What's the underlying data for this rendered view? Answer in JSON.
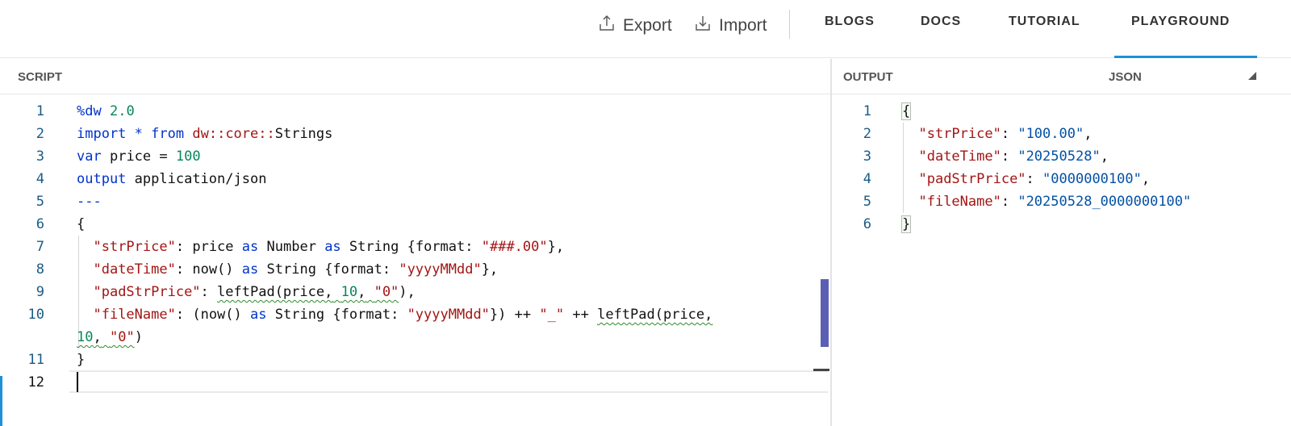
{
  "header": {
    "export_label": "Export",
    "import_label": "Import",
    "nav": [
      "BLOGS",
      "DOCS",
      "TUTORIAL",
      "PLAYGROUND"
    ],
    "active_nav": "PLAYGROUND"
  },
  "script_panel": {
    "title": "SCRIPT",
    "line_numbers": [
      "1",
      "2",
      "3",
      "4",
      "5",
      "6",
      "7",
      "8",
      "9",
      "10",
      "11",
      "12"
    ],
    "lines": {
      "l1": {
        "directive": "%dw",
        "version": "2.0"
      },
      "l2": {
        "kw_import": "import",
        "star": "*",
        "kw_from": "from",
        "module": "dw::core::",
        "module_name": "Strings"
      },
      "l3": {
        "kw_var": "var",
        "name": "price",
        "eq": "=",
        "value": "100"
      },
      "l4": {
        "kw_output": "output",
        "mime": "application/json"
      },
      "l5": {
        "separator": "---"
      },
      "l6": {
        "brace": "{"
      },
      "l7": {
        "key": "\"strPrice\"",
        "colon": ":",
        "expr1": "price",
        "as1": "as",
        "type1": "Number",
        "as2": "as",
        "type2": "String",
        "open": "{format:",
        "fmt": "\"###.00\"",
        "close": "},"
      },
      "l8": {
        "key": "\"dateTime\"",
        "colon": ":",
        "expr1": "now()",
        "as1": "as",
        "type1": "String",
        "open": "{format:",
        "fmt": "\"yyyyMMdd\"",
        "close": "},"
      },
      "l9": {
        "key": "\"padStrPrice\"",
        "colon": ":",
        "fn": "leftPad(price,",
        "arg1": "10",
        "comma": ",",
        "arg2": "\"0\"",
        "close": "),"
      },
      "l10": {
        "key": "\"fileName\"",
        "colon": ":",
        "open": "(now()",
        "as1": "as",
        "type1": "String",
        "open2": "{format:",
        "fmt": "\"yyyyMMdd\"",
        "close": "})",
        "concat1": "++",
        "underscore": "\"_\"",
        "concat2": "++",
        "fn": "leftPad(price,"
      },
      "l10b": {
        "arg1": "10",
        "comma": ",",
        "arg2": "\"0\"",
        "close": ")"
      },
      "l11": {
        "brace": "}"
      }
    }
  },
  "output_panel": {
    "title": "OUTPUT",
    "format": "JSON",
    "line_numbers": [
      "1",
      "2",
      "3",
      "4",
      "5",
      "6"
    ],
    "open_brace": "{",
    "close_brace": "}",
    "entries": [
      {
        "key": "\"strPrice\"",
        "value": "\"100.00\"",
        "tail": ","
      },
      {
        "key": "\"dateTime\"",
        "value": "\"20250528\"",
        "tail": ","
      },
      {
        "key": "\"padStrPrice\"",
        "value": "\"0000000100\"",
        "tail": ","
      },
      {
        "key": "\"fileName\"",
        "value": "\"20250528_0000000100\"",
        "tail": ""
      }
    ]
  },
  "colors": {
    "accent": "#1e90d6",
    "keyword": "#0033cc",
    "number": "#098658",
    "string": "#a31515",
    "json_value": "#0451a5",
    "scroll_thumb": "#5b5fb4"
  }
}
